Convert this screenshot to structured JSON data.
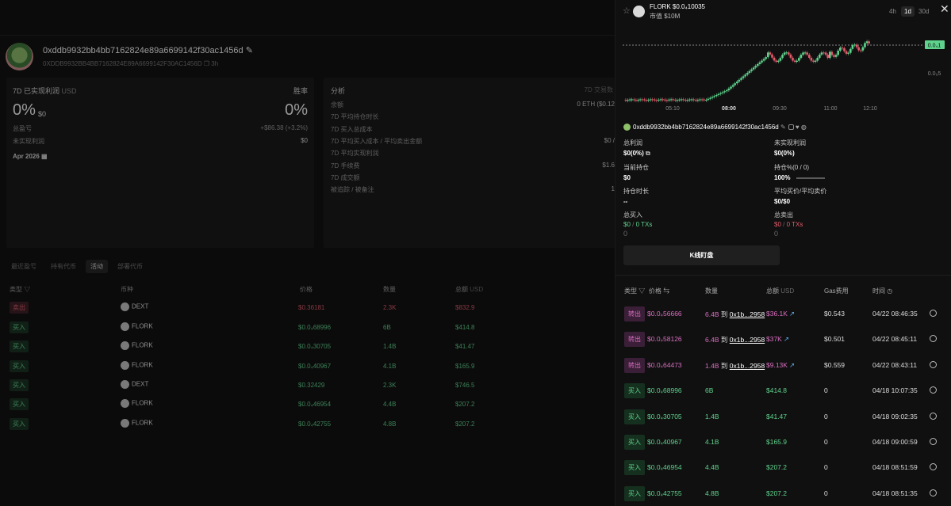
{
  "wallet": {
    "address": "0xddb9932bb4bb7162824e89a6699142f30ac1456d",
    "address_upper": "0XDDB9932BB4BB7162824E89A6699142F30AC1456D",
    "age": "3h"
  },
  "pnl_panel": {
    "title": "7D 已实现利润",
    "currency": "USD",
    "winrate_label": "胜率",
    "pnl_pct": "0%",
    "pnl_usd": "$0",
    "winrate_pct": "0%",
    "total_label": "总盈亏",
    "total_value": "+$86.38 (+3.2%)",
    "unrealized_label": "未实现利润",
    "unrealized_value": "$0",
    "month": "Apr 2026"
  },
  "analysis_panel": {
    "title": "分析",
    "rows": [
      {
        "label": "余额",
        "value": "0 ETH ($0.12"
      },
      {
        "label": "7D 平均持仓时长",
        "value": ""
      },
      {
        "label": "7D 买入总成本",
        "value": ""
      },
      {
        "label": "7D 平均买入成本 / 平均卖出金额",
        "value": "$0 /"
      },
      {
        "label": "7D 平均实现利润",
        "value": ""
      },
      {
        "label": "7D 手续费",
        "value": "$1.6"
      },
      {
        "label": "7D 成交额",
        "value": ""
      },
      {
        "label": "被追踪 / 被备注",
        "value": "1"
      }
    ],
    "right_label": "7D 交易数"
  },
  "bg_tabs": [
    "最近盈亏",
    "持有代币",
    "活动",
    "部署代币"
  ],
  "bg_table": {
    "headers": [
      "类型",
      "币种",
      "价格",
      "数量",
      "总额",
      "USD"
    ],
    "rows": [
      {
        "type": "卖出",
        "kind": "sell",
        "token": "DEXT",
        "price": "$0.36181",
        "qty": "2.3K",
        "total": "$832.9"
      },
      {
        "type": "买入",
        "kind": "buy",
        "token": "FLORK",
        "price": "$0.0₄68996",
        "qty": "6B",
        "total": "$414.8"
      },
      {
        "type": "买入",
        "kind": "buy",
        "token": "FLORK",
        "price": "$0.0₄30705",
        "qty": "1.4B",
        "total": "$41.47"
      },
      {
        "type": "买入",
        "kind": "buy",
        "token": "FLORK",
        "price": "$0.0₄40967",
        "qty": "4.1B",
        "total": "$165.9"
      },
      {
        "type": "买入",
        "kind": "buy",
        "token": "DEXT",
        "price": "$0.32429",
        "qty": "2.3K",
        "total": "$746.5"
      },
      {
        "type": "买入",
        "kind": "buy",
        "token": "FLORK",
        "price": "$0.0₄46954",
        "qty": "4.4B",
        "total": "$207.2"
      },
      {
        "type": "买入",
        "kind": "buy",
        "token": "FLORK",
        "price": "$0.0₄42755",
        "qty": "4.8B",
        "total": "$207.2"
      }
    ]
  },
  "token": {
    "name": "FLORK",
    "price": "$0.0₄10035",
    "mcap": "市值 $10M",
    "timeframes": [
      "4h",
      "1d",
      "30d"
    ],
    "active_timeframe": "1d"
  },
  "chart_data": {
    "type": "candlestick",
    "x_ticks": [
      "05:10",
      "08:00",
      "09:30",
      "11:00",
      "12:10"
    ],
    "y_ticks": [
      "0.0₄1",
      "0.0₅5"
    ],
    "current_price_label": "0.0₄1"
  },
  "holder": {
    "address": "0xddb9932bb4bb7162824e89a6699142f30ac1456d",
    "stats": [
      {
        "label": "总利润",
        "value": "$0(0%)"
      },
      {
        "label": "未实现利润",
        "value": "$0(0%)"
      },
      {
        "label": "当前持仓",
        "value": "$0"
      },
      {
        "label": "持仓%(0 / 0)",
        "value": "100%"
      },
      {
        "label": "持仓时长",
        "value": "--"
      },
      {
        "label": "平均买价/平均卖价",
        "value": "$0/$0"
      }
    ],
    "total_buy_label": "总买入",
    "total_buy_value": "$0",
    "total_buy_txs": "0 TXs",
    "total_buy_extra": "0",
    "total_sell_label": "总卖出",
    "total_sell_value": "$0",
    "total_sell_txs": "0 TXs",
    "total_sell_extra": "0",
    "kline_button": "K线盯盘"
  },
  "trades": {
    "headers": {
      "type": "类型",
      "price": "价格",
      "qty": "数量",
      "total": "总额",
      "usd": "USD",
      "gas": "Gas费用",
      "time": "时间"
    },
    "rows": [
      {
        "type": "转出",
        "kind": "out",
        "price": "$0.0₄56666",
        "qty": "6.4B",
        "to": "到",
        "dest": "0x1b...2958",
        "total": "$36.1K",
        "gas": "$0.543",
        "time": "04/22 08:46:35"
      },
      {
        "type": "转出",
        "kind": "out",
        "price": "$0.0₄58126",
        "qty": "6.4B",
        "to": "到",
        "dest": "0x1b...2958",
        "total": "$37K",
        "gas": "$0.501",
        "time": "04/22 08:45:11"
      },
      {
        "type": "转出",
        "kind": "out",
        "price": "$0.0₄64473",
        "qty": "1.4B",
        "to": "到",
        "dest": "0x1b...2958",
        "total": "$9.13K",
        "gas": "$0.559",
        "time": "04/22 08:43:11"
      },
      {
        "type": "买入",
        "kind": "buy",
        "price": "$0.0₄68996",
        "qty": "6B",
        "to": "",
        "dest": "",
        "total": "$414.8",
        "gas": "0",
        "time": "04/18 10:07:35"
      },
      {
        "type": "买入",
        "kind": "buy",
        "price": "$0.0₄30705",
        "qty": "1.4B",
        "to": "",
        "dest": "",
        "total": "$41.47",
        "gas": "0",
        "time": "04/18 09:02:35"
      },
      {
        "type": "买入",
        "kind": "buy",
        "price": "$0.0₄40967",
        "qty": "4.1B",
        "to": "",
        "dest": "",
        "total": "$165.9",
        "gas": "0",
        "time": "04/18 09:00:59"
      },
      {
        "type": "买入",
        "kind": "buy",
        "price": "$0.0₄46954",
        "qty": "4.4B",
        "to": "",
        "dest": "",
        "total": "$207.2",
        "gas": "0",
        "time": "04/18 08:51:59"
      },
      {
        "type": "买入",
        "kind": "buy",
        "price": "$0.0₄42755",
        "qty": "4.8B",
        "to": "",
        "dest": "",
        "total": "$207.2",
        "gas": "0",
        "time": "04/18 08:51:35"
      }
    ]
  },
  "colors": {
    "buy": "#5fd38d",
    "sell": "#e05a6a",
    "transfer": "#d86ec0",
    "bg": "#0b0b0b",
    "panel": "#101010"
  }
}
